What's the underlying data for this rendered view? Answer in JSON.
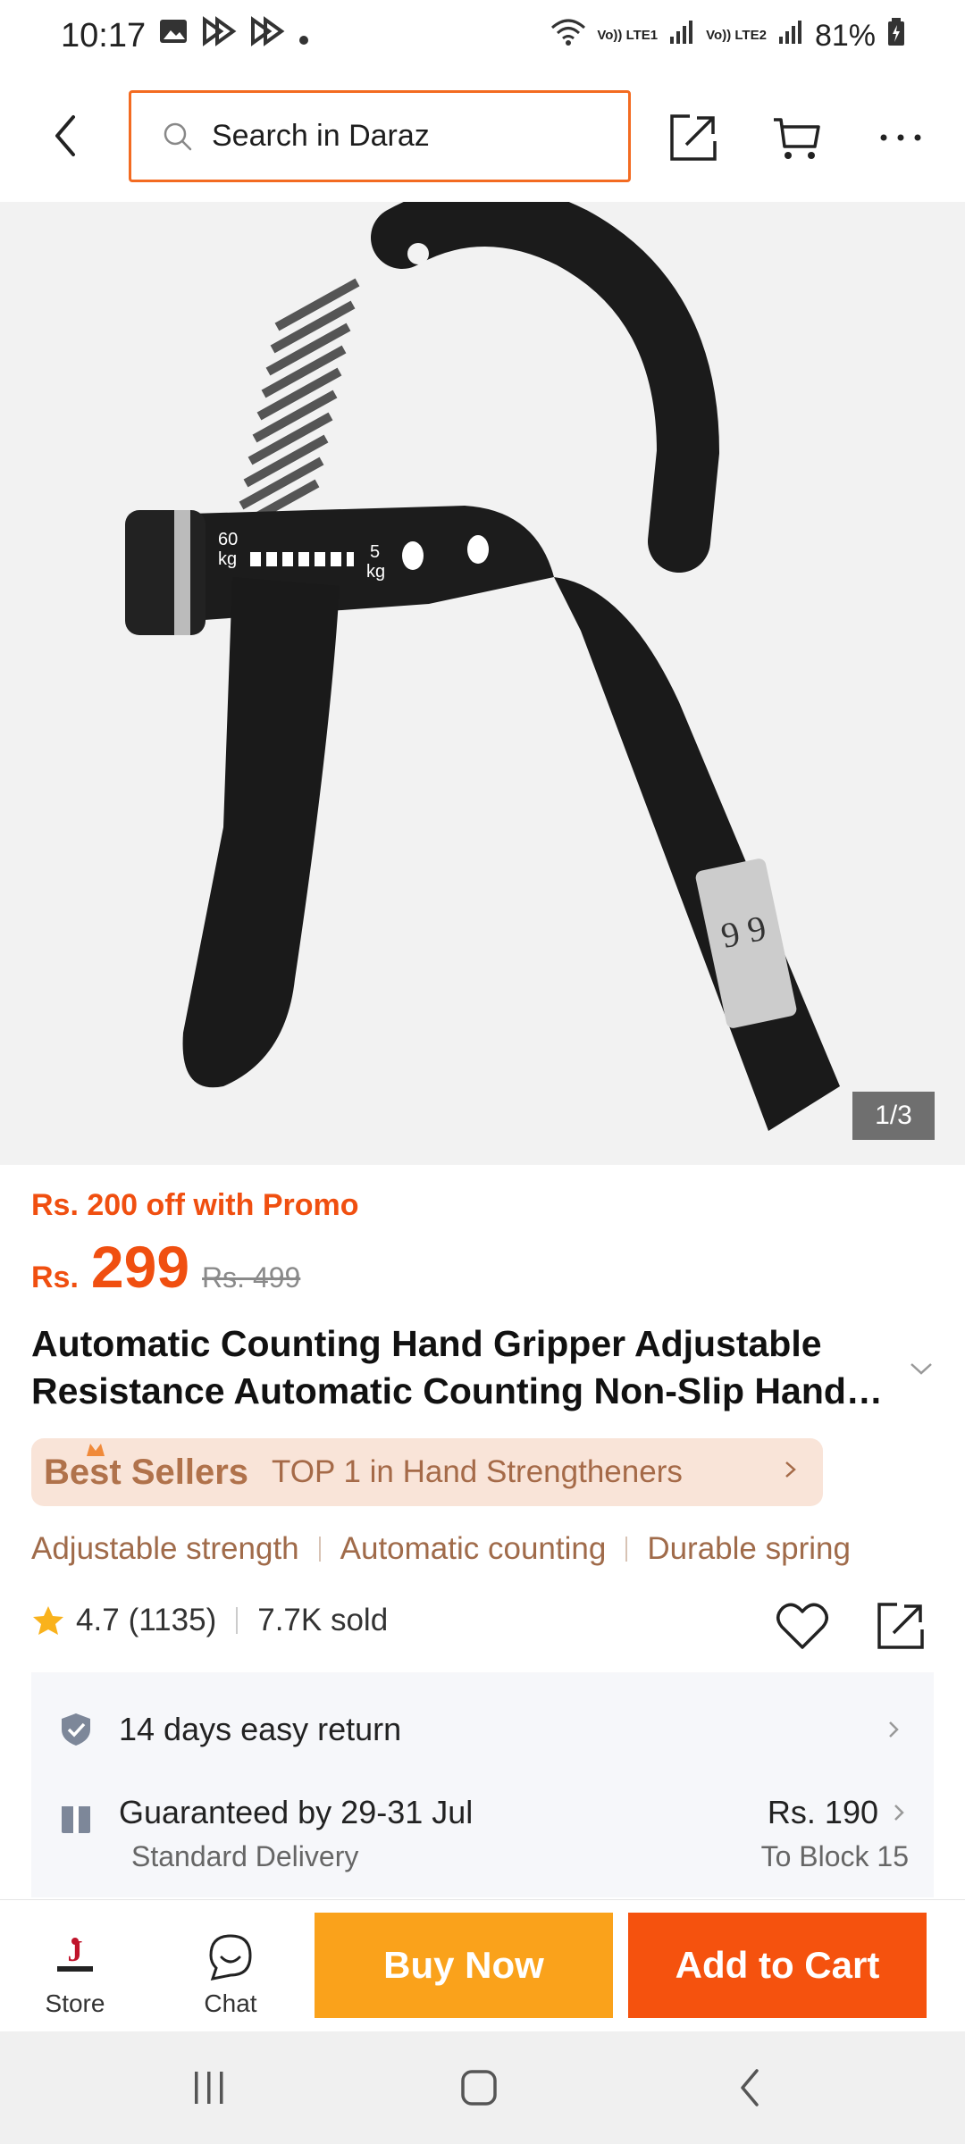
{
  "status_bar": {
    "time": "10:17",
    "net1": "Vo)) LTE1",
    "net2": "Vo)) LTE2",
    "battery": "81%"
  },
  "header": {
    "search_placeholder": "Search in Daraz",
    "icons": [
      "back-icon",
      "share-icon",
      "cart-icon",
      "more-icon"
    ]
  },
  "gallery": {
    "counter": "1/3"
  },
  "price": {
    "promo": "Rs. 200 off with Promo",
    "currency": "Rs.",
    "current": "299",
    "original": "Rs. 499"
  },
  "product": {
    "title": "Automatic Counting Hand Gripper Adjustable Resistance Automatic Counting Non-Slip Hand Gripper"
  },
  "bestseller": {
    "title": "Best Sellers",
    "rank": "TOP 1 in Hand Strengtheners"
  },
  "features": [
    "Adjustable strength",
    "Automatic counting",
    "Durable spring"
  ],
  "rating": {
    "score": "4.7",
    "count": "(1135)",
    "sold": "7.7K sold"
  },
  "services": {
    "return_text": "14 days easy return",
    "delivery_title": "Guaranteed by 29-31 Jul",
    "delivery_type": "Standard Delivery",
    "delivery_price": "Rs. 190",
    "delivery_location": "To Block 15"
  },
  "bottom_bar": {
    "store_label": "Store",
    "chat_label": "Chat",
    "buy_now": "Buy Now",
    "add_to_cart": "Add to Cart"
  },
  "colors": {
    "accent": "#f5520e",
    "buy_now": "#faa21b",
    "promo": "#f04f10"
  }
}
